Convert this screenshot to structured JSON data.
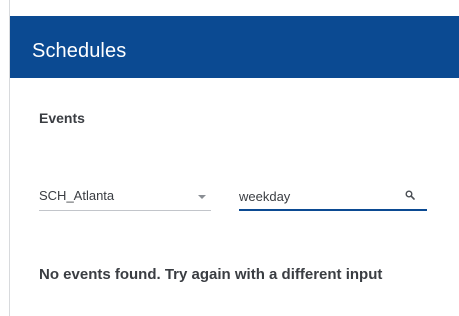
{
  "header": {
    "title": "Schedules"
  },
  "events": {
    "section_title": "Events",
    "schedule_select": {
      "selected": "SCH_Atlanta"
    },
    "search": {
      "value": "weekday"
    },
    "empty_message": "No events found. Try again with a different input"
  },
  "colors": {
    "header_bg": "#0b4a92",
    "accent_underline": "#0b4a92",
    "text": "#3a3d42"
  },
  "icons": {
    "search": "search-icon",
    "dropdown": "chevron-down-icon"
  }
}
